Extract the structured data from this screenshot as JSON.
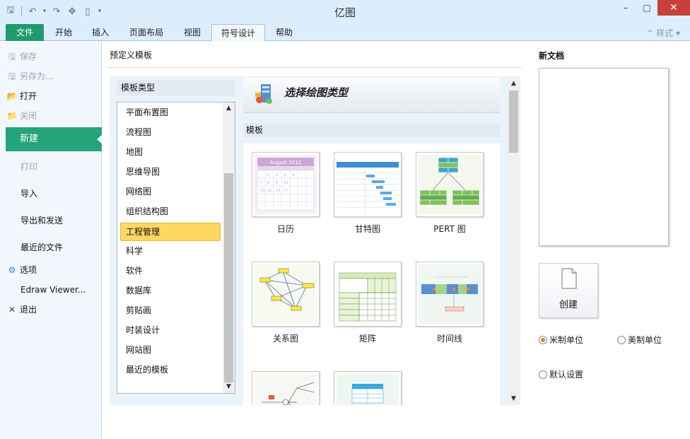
{
  "window": {
    "title": "亿图",
    "min": "–",
    "max": "□",
    "close": "✕"
  },
  "quick_access": {
    "save": "🖫",
    "undo": "↶",
    "redo": "↷",
    "dropdown": "▾"
  },
  "ribbon": {
    "tabs": [
      "文件",
      "开始",
      "插入",
      "页面布局",
      "视图",
      "符号设计",
      "帮助"
    ],
    "active_tab": "符号设计",
    "style_label": "样式"
  },
  "backstage": {
    "items": [
      {
        "label": "保存",
        "icon": "save-icon",
        "glyph": "🖫",
        "disabled": true
      },
      {
        "label": "另存为...",
        "icon": "save-as-icon",
        "glyph": "🖫",
        "disabled": true
      },
      {
        "label": "打开",
        "icon": "open-folder-icon",
        "glyph": "📂",
        "disabled": false
      },
      {
        "label": "关闭",
        "icon": "close-folder-icon",
        "glyph": "📁",
        "disabled": true
      }
    ],
    "new_label": "新建",
    "print_label": "打印",
    "import_label": "导入",
    "export_label": "导出和发送",
    "recent_label": "最近的文件",
    "options_label": "选项",
    "viewer_label": "Edraw Viewer...",
    "exit_label": "退出"
  },
  "main": {
    "title": "预定义模板",
    "category_header": "模板类型",
    "categories": [
      "平面布置图",
      "流程图",
      "地图",
      "思维导图",
      "网络图",
      "组织结构图",
      "工程管理",
      "科学",
      "软件",
      "数据库",
      "剪贴画",
      "时装设计",
      "网站图",
      "最近的模板"
    ],
    "selected_category": "工程管理",
    "banner_title": "选择绘图类型",
    "templates_header": "模板",
    "templates": [
      {
        "label": "日历",
        "calendar_month": "August 2011"
      },
      {
        "label": "甘特图"
      },
      {
        "label": "PERT 图"
      },
      {
        "label": "关系图"
      },
      {
        "label": "矩阵"
      },
      {
        "label": "时间线"
      },
      {
        "label": ""
      },
      {
        "label": ""
      }
    ]
  },
  "right": {
    "title": "新文档",
    "create_label": "创建",
    "metric": "米制单位",
    "us": "美制单位",
    "default": "默认设置",
    "selected_unit": "米制单位"
  }
}
